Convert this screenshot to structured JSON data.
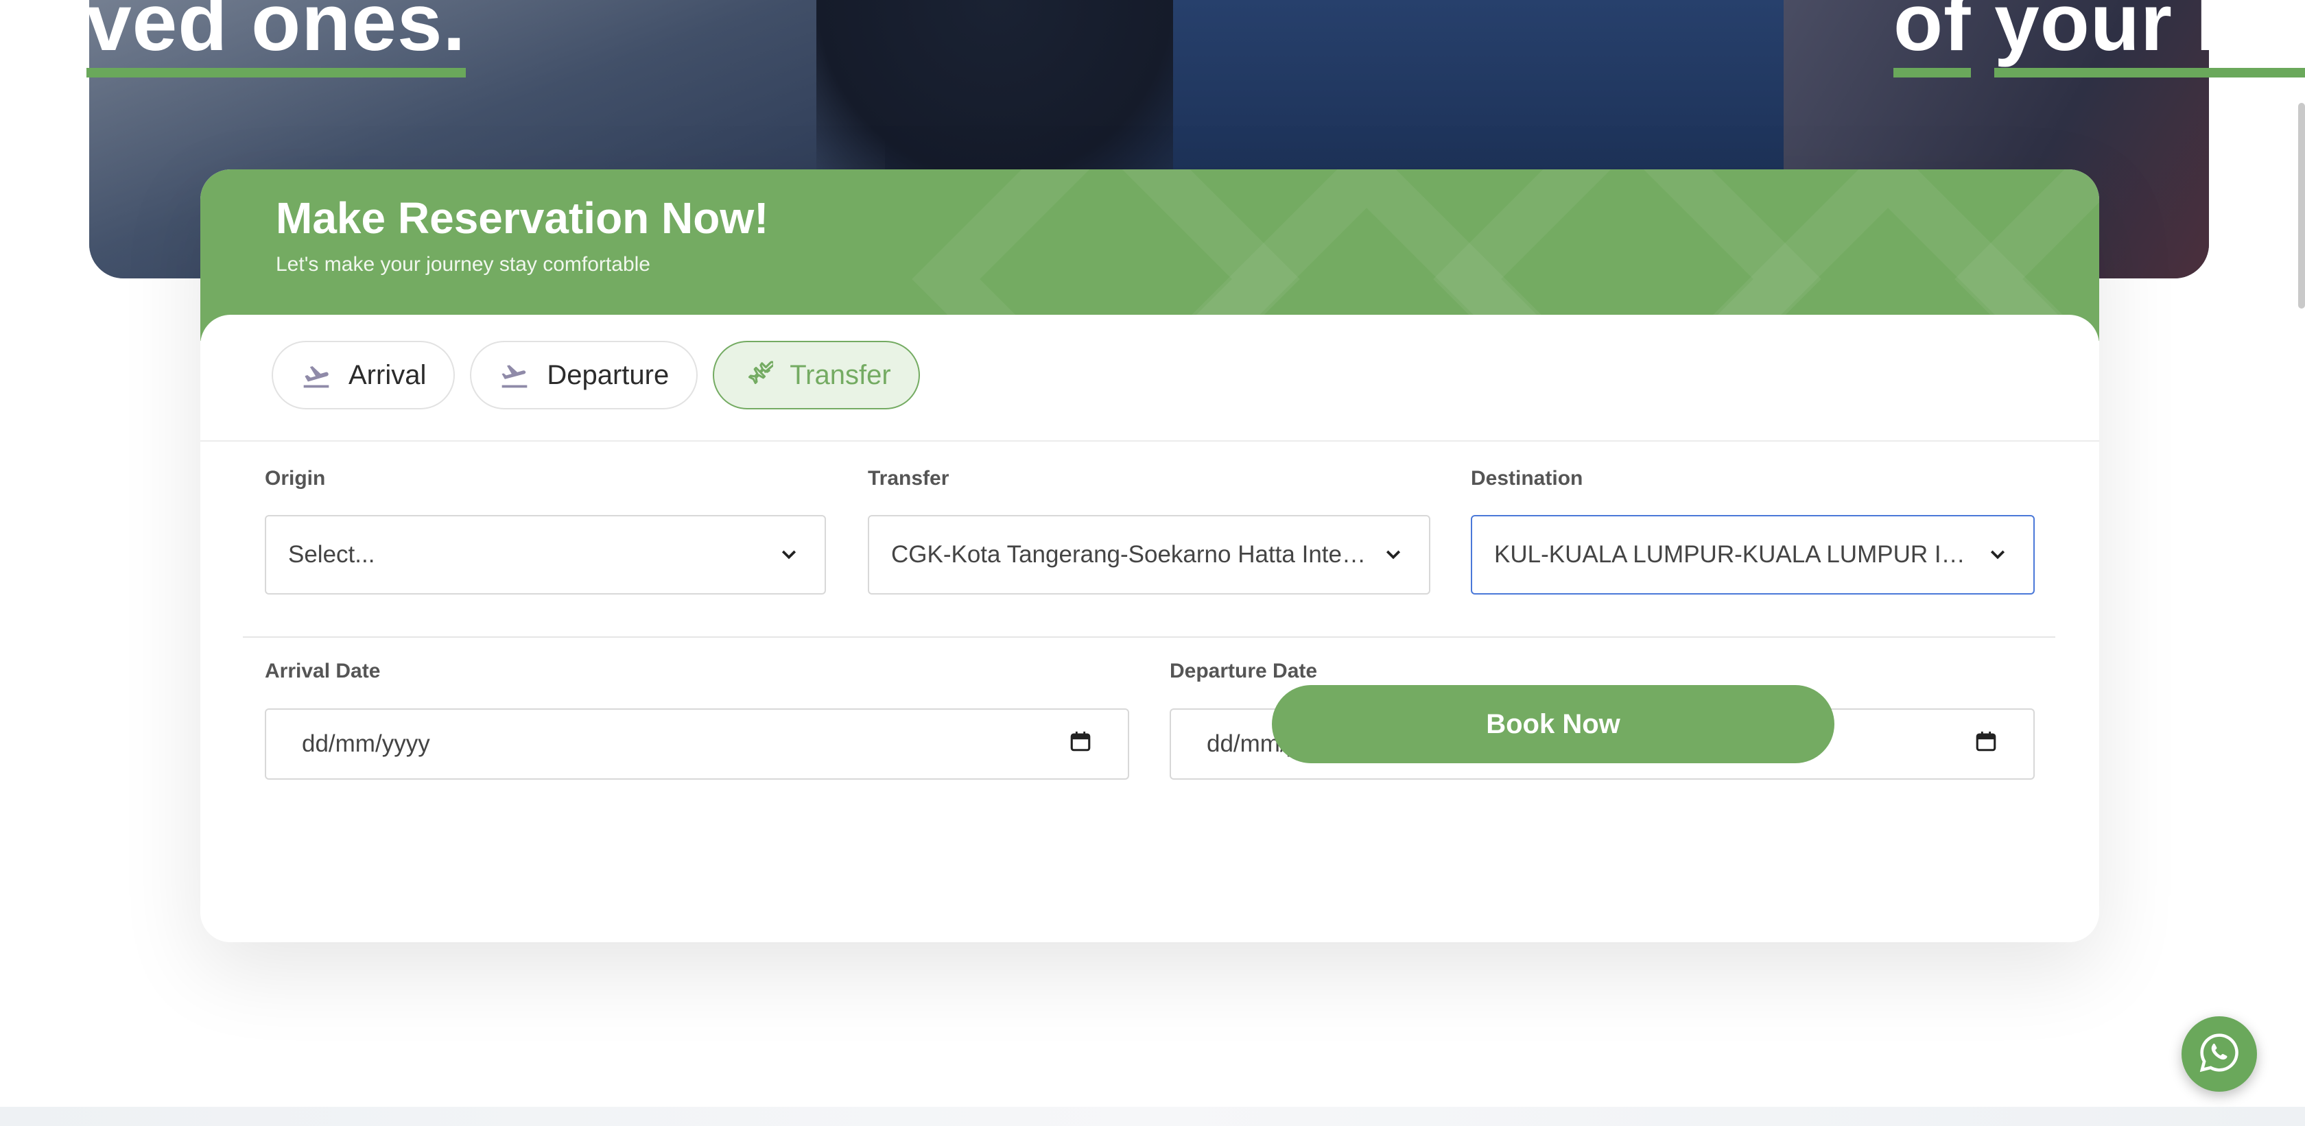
{
  "hero": {
    "text_left_a": "ved ones",
    "text_left_b": ".",
    "text_right_a": "of",
    "text_right_b": "your lov"
  },
  "reservation": {
    "title": "Make Reservation Now!",
    "subtitle": "Let's make your journey stay comfortable"
  },
  "tabs": [
    {
      "label": "Arrival",
      "icon": "plane-landing-icon",
      "active": false
    },
    {
      "label": "Departure",
      "icon": "plane-takeoff-icon",
      "active": false
    },
    {
      "label": "Transfer",
      "icon": "plane-transfer-icon",
      "active": true
    }
  ],
  "form": {
    "origin": {
      "label": "Origin",
      "value": "Select..."
    },
    "transfer": {
      "label": "Transfer",
      "value": "CGK-Kota Tangerang-Soekarno Hatta Inter..."
    },
    "destination": {
      "label": "Destination",
      "value": "KUL-KUALA LUMPUR-KUALA LUMPUR INTE..."
    },
    "arrival_date": {
      "label": "Arrival Date",
      "placeholder": "dd/mm/yyyy"
    },
    "departure_date": {
      "label": "Departure Date",
      "placeholder": "dd/mm/yyyy"
    },
    "book_button": "Book Now"
  },
  "colors": {
    "accent": "#74ab62",
    "focus": "#4a78d8"
  }
}
